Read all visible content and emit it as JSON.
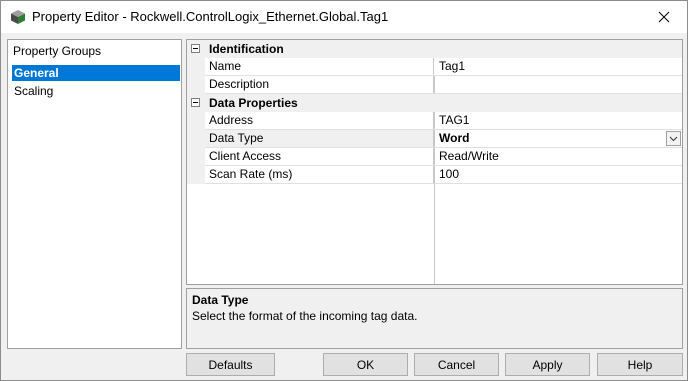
{
  "window": {
    "title": "Property Editor - Rockwell.ControlLogix_Ethernet.Global.Tag1",
    "app_icon": "kepware-cube-icon",
    "close_icon": "close-icon"
  },
  "groups": {
    "header": "Property Groups",
    "items": [
      {
        "label": "General",
        "selected": true
      },
      {
        "label": "Scaling",
        "selected": false
      }
    ]
  },
  "grid": {
    "categories": [
      {
        "label": "Identification",
        "properties": [
          {
            "name": "Name",
            "value": "Tag1"
          },
          {
            "name": "Description",
            "value": ""
          }
        ]
      },
      {
        "label": "Data Properties",
        "properties": [
          {
            "name": "Address",
            "value": "TAG1"
          },
          {
            "name": "Data Type",
            "value": "Word",
            "selected": true,
            "has_dropdown": true
          },
          {
            "name": "Client Access",
            "value": "Read/Write"
          },
          {
            "name": "Scan Rate (ms)",
            "value": "100"
          }
        ]
      }
    ]
  },
  "description": {
    "title": "Data Type",
    "text": "Select the format of the incoming tag data."
  },
  "buttons": {
    "defaults": "Defaults",
    "ok": "OK",
    "cancel": "Cancel",
    "apply": "Apply",
    "help": "Help"
  },
  "colors": {
    "selection": "#0078d7",
    "window_bg": "#f0f0f0"
  }
}
